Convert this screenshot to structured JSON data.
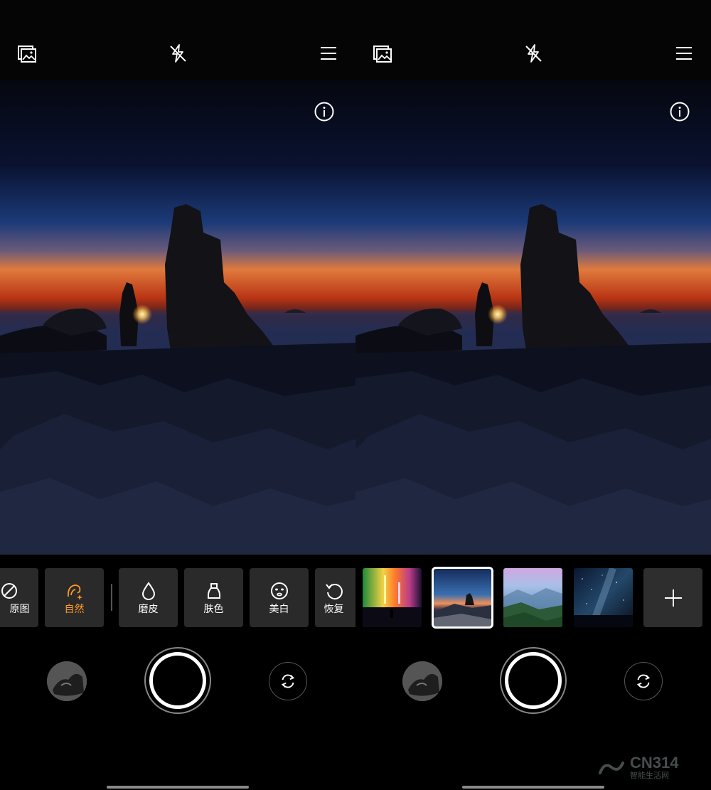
{
  "left_screen": {
    "top_icons": [
      "gallery-icon",
      "flash-off-icon",
      "menu-icon"
    ],
    "info_icon": "info-icon",
    "beauty_options": [
      {
        "label": "原图",
        "icon": "no-filter-icon",
        "active": false
      },
      {
        "label": "自然",
        "icon": "natural-beauty-icon",
        "active": true
      },
      {
        "label": "磨皮",
        "icon": "smooth-skin-icon",
        "active": false
      },
      {
        "label": "肤色",
        "icon": "skin-tone-icon",
        "active": false
      },
      {
        "label": "美白",
        "icon": "whiten-face-icon",
        "active": false
      },
      {
        "label": "恢复",
        "icon": "reset-icon",
        "active": false
      }
    ],
    "accent_color": "#ff9a28"
  },
  "right_screen": {
    "top_icons": [
      "gallery-icon",
      "flash-off-icon",
      "menu-icon"
    ],
    "info_icon": "info-icon",
    "sky_presets": [
      {
        "name": "neon-city-preset",
        "selected": false
      },
      {
        "name": "sunset-coast-preset",
        "selected": true
      },
      {
        "name": "misty-mountains-preset",
        "selected": false
      },
      {
        "name": "starry-sky-preset",
        "selected": false
      }
    ],
    "add_icon": "plus-icon"
  },
  "watermark": {
    "big": "CN314",
    "small": "智能生活网"
  }
}
